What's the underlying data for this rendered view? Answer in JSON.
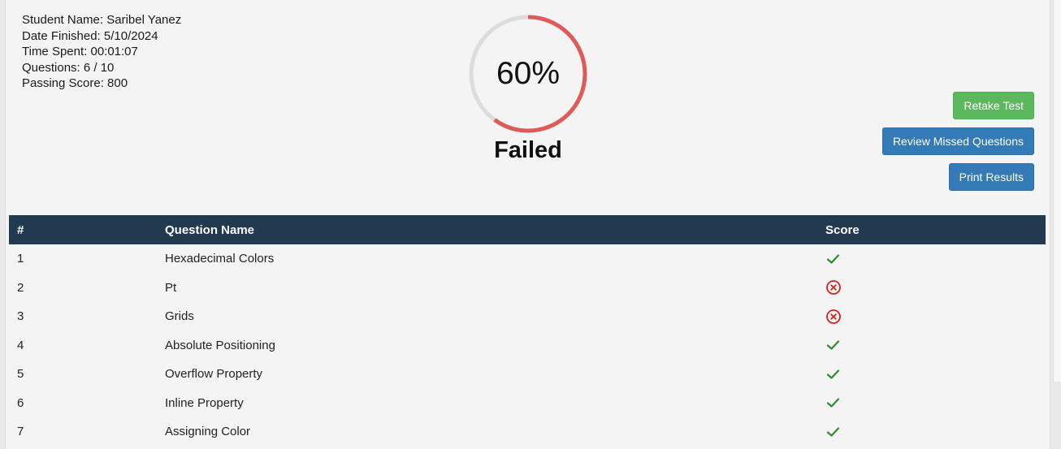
{
  "student": {
    "name_line": "Student Name: Saribel Yanez",
    "date_line": "Date Finished: 5/10/2024",
    "time_line": "Time Spent: 00:01:07",
    "questions_line": "Questions: 6 / 10",
    "passing_line": "Passing Score: 800"
  },
  "result": {
    "percent_label": "60%",
    "percent_value": 60,
    "status": "Failed",
    "ring_color": "#e05a5a",
    "track_color": "#dcdcdc"
  },
  "actions": {
    "retake": "Retake Test",
    "review": "Review Missed Questions",
    "print": "Print Results"
  },
  "table": {
    "headers": [
      "#",
      "Question Name",
      "Score"
    ],
    "rows": [
      {
        "num": "1",
        "name": "Hexadecimal Colors",
        "score": "correct"
      },
      {
        "num": "2",
        "name": "Pt",
        "score": "incorrect"
      },
      {
        "num": "3",
        "name": "Grids",
        "score": "incorrect"
      },
      {
        "num": "4",
        "name": "Absolute Positioning",
        "score": "correct"
      },
      {
        "num": "5",
        "name": "Overflow Property",
        "score": "correct"
      },
      {
        "num": "6",
        "name": "Inline Property",
        "score": "correct"
      },
      {
        "num": "7",
        "name": "Assigning Color",
        "score": "correct"
      }
    ]
  },
  "colors": {
    "header_bg": "#213a50",
    "correct": "#2e8b2e",
    "incorrect": "#d62020"
  }
}
